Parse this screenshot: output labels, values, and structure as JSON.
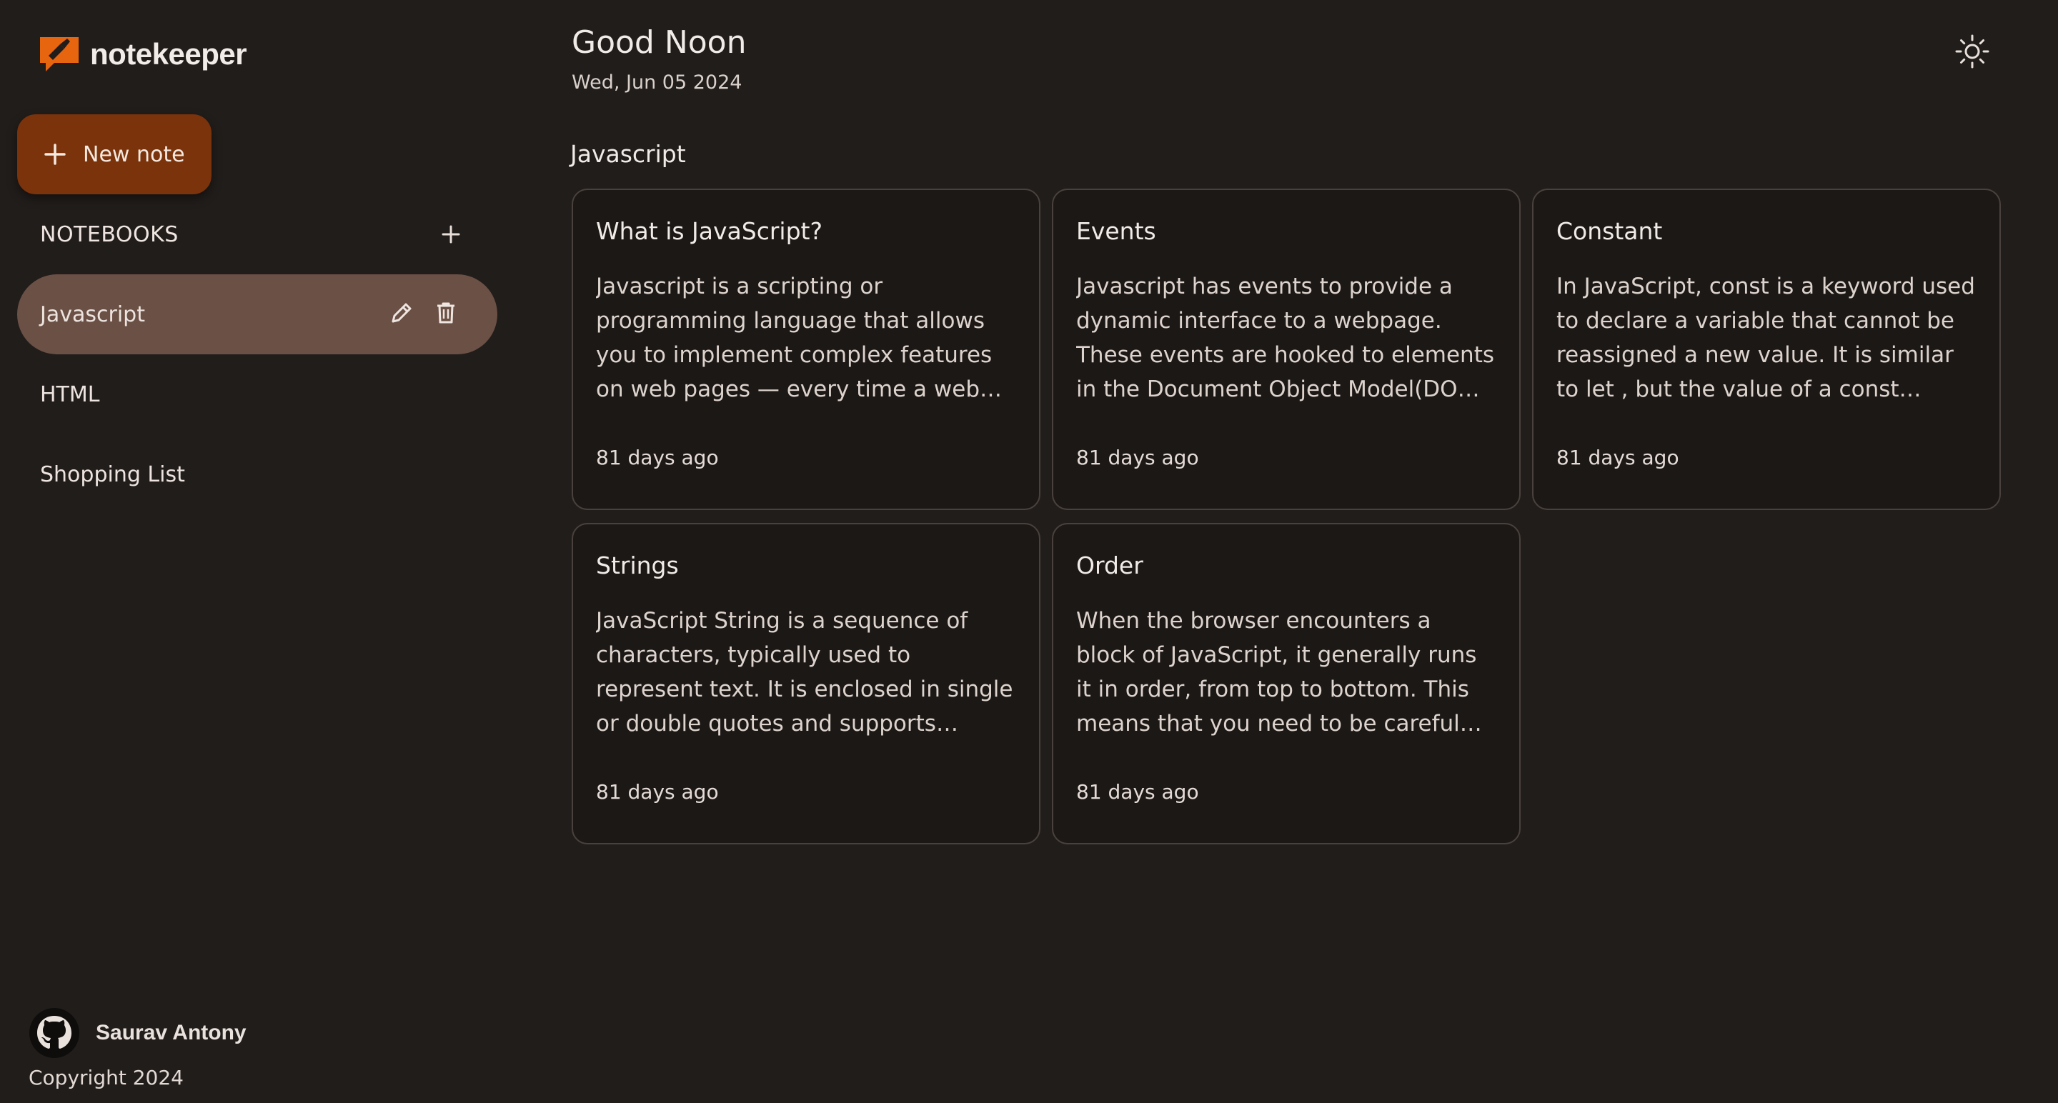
{
  "app": {
    "name": "notekeeper"
  },
  "sidebar": {
    "new_note_label": "New note",
    "notebooks_title": "NOTEBOOKS",
    "notebooks": [
      {
        "label": "Javascript",
        "active": true
      },
      {
        "label": "HTML",
        "active": false
      },
      {
        "label": "Shopping List",
        "active": false
      }
    ],
    "footer": {
      "author": "Saurav Antony",
      "copyright": "Copyright 2024"
    }
  },
  "header": {
    "greeting": "Good Noon",
    "date": "Wed, Jun 05 2024",
    "theme_icon": "sun-icon"
  },
  "main": {
    "section_title": "Javascript",
    "notes": [
      {
        "title": "What is JavaScript?",
        "body": "Javascript is a scripting or programming language that allows you to implement complex features on web pages — every time a web page does more than just sit there and display static information for you to look at.",
        "time": "81 days ago"
      },
      {
        "title": "Events",
        "body": "Javascript has events to provide a dynamic interface to a webpage. These events are hooked to elements in the Document Object Model(DOM). These events by default use bubbling propagation.",
        "time": "81 days ago"
      },
      {
        "title": "Constant",
        "body": "In JavaScript, const is a keyword used to declare a variable that cannot be reassigned a new value. It is similar to let , but the value of a const variable cannot be changed once assigned.",
        "time": "81 days ago"
      },
      {
        "title": "Strings",
        "body": "JavaScript String is a sequence of characters, typically used to represent text. It is enclosed in single or double quotes and supports various methods for text manipulation.",
        "time": "81 days ago"
      },
      {
        "title": "Order",
        "body": "When the browser encounters a block of JavaScript, it generally runs it in order, from top to bottom. This means that you need to be careful what order you put things in.",
        "time": "81 days ago"
      }
    ]
  },
  "colors": {
    "background": "#211d1b",
    "accent": "#7a330b",
    "logo": "#e8650f",
    "active_notebook": "#6b5045",
    "card_border": "#4a413c"
  }
}
